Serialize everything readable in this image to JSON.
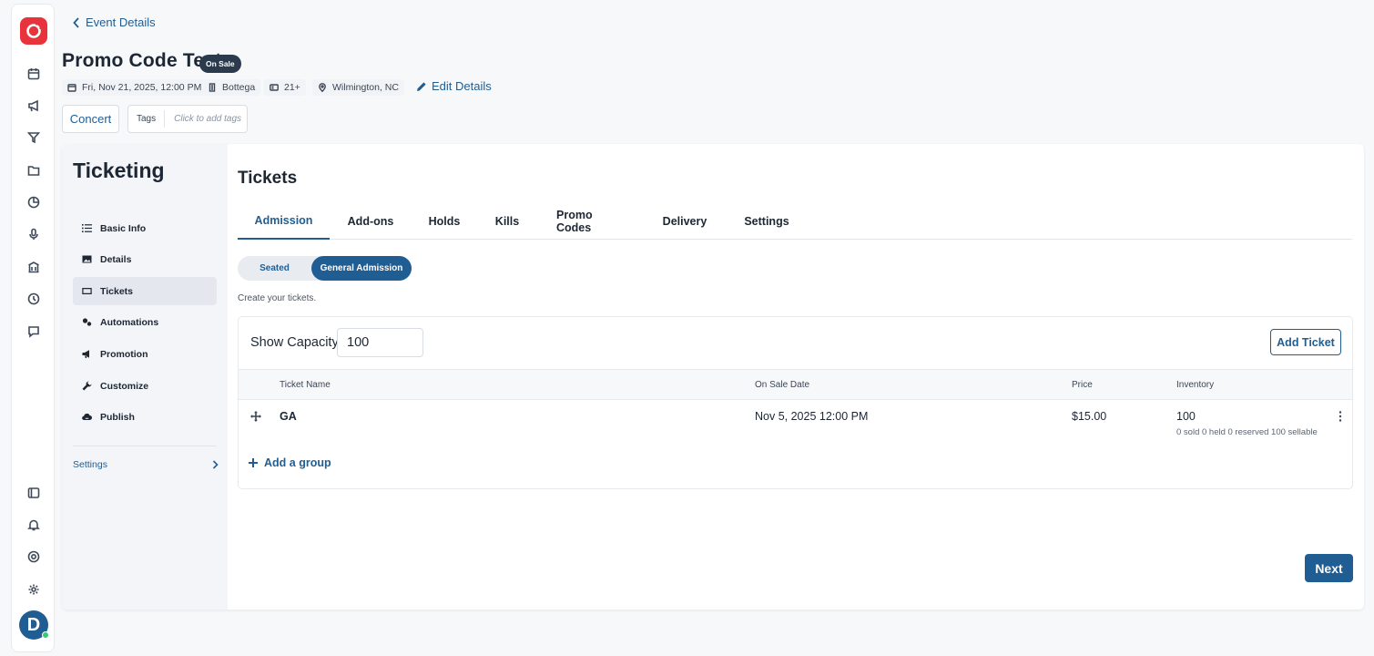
{
  "header": {
    "back_label": "Event Details",
    "title": "Promo Code Test",
    "status_badge": "On Sale",
    "meta": {
      "date": "Fri, Nov 21, 2025, 12:00 PM",
      "venue": "Bottega",
      "age": "21+",
      "location": "Wilmington, NC"
    },
    "edit_label": "Edit Details",
    "genre_tag": "Concert",
    "tags_label": "Tags",
    "tags_placeholder": "Click to add tags"
  },
  "sidebar": {
    "heading": "Ticketing",
    "items": [
      {
        "label": "Basic Info",
        "icon": "list-icon"
      },
      {
        "label": "Details",
        "icon": "image-icon"
      },
      {
        "label": "Tickets",
        "icon": "ticket-icon"
      },
      {
        "label": "Automations",
        "icon": "gears-icon"
      },
      {
        "label": "Promotion",
        "icon": "megaphone-icon"
      },
      {
        "label": "Customize",
        "icon": "wrench-icon"
      },
      {
        "label": "Publish",
        "icon": "cloud-icon"
      }
    ],
    "active_item": "Tickets",
    "settings_label": "Settings"
  },
  "main": {
    "heading": "Tickets",
    "tabs": [
      "Admission",
      "Add-ons",
      "Holds",
      "Kills",
      "Promo Codes",
      "Delivery",
      "Settings"
    ],
    "active_tab": "Admission",
    "toggle": {
      "option_a": "Seated",
      "option_b": "General Admission",
      "selected": "General Admission"
    },
    "hint": "Create your tickets.",
    "capacity_label": "Show Capacity",
    "capacity_value": "100",
    "add_ticket_label": "Add Ticket",
    "columns": {
      "name": "Ticket Name",
      "on_sale": "On Sale Date",
      "price": "Price",
      "inventory": "Inventory"
    },
    "tickets": [
      {
        "name": "GA",
        "on_sale_date": "Nov 5, 2025 12:00 PM",
        "price": "$15.00",
        "inventory": "100",
        "inventory_detail": "0 sold 0 held 0 reserved 100 sellable"
      }
    ],
    "add_group_label": "Add a group",
    "next_label": "Next"
  },
  "user": {
    "avatar_initial": "D",
    "online": true
  },
  "colors": {
    "brand": "#e8323c",
    "primary": "#1f5d93",
    "dark_badge": "#2b3a4d",
    "online": "#37c871"
  }
}
